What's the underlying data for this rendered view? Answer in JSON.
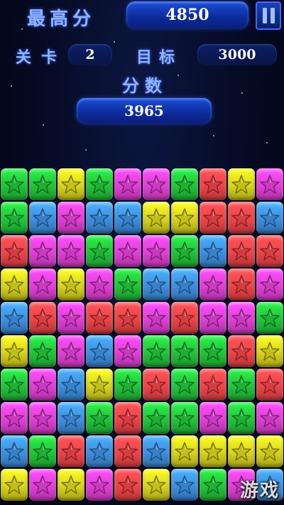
{
  "hud": {
    "high_score_label": "最高分",
    "high_score_value": "4850",
    "level_label": "关卡",
    "level_value": "2",
    "target_label": "目标",
    "target_value": "3000",
    "score_label": "分数",
    "score_value": "3965"
  },
  "board": {
    "columns": 10,
    "rows": 10,
    "colors": {
      "G": "#22c43a",
      "B": "#3d8fe0",
      "Y": "#d8d41c",
      "P": "#e23fd6",
      "R": "#ee4448"
    },
    "grid": [
      [
        "G",
        "G",
        "Y",
        "G",
        "P",
        "P",
        "G",
        "R",
        "Y",
        "P"
      ],
      [
        "G",
        "B",
        "P",
        "B",
        "B",
        "Y",
        "Y",
        "R",
        "R",
        "B"
      ],
      [
        "R",
        "P",
        "P",
        "G",
        "P",
        "P",
        "G",
        "B",
        "R",
        "R"
      ],
      [
        "Y",
        "P",
        "Y",
        "P",
        "G",
        "B",
        "B",
        "P",
        "R",
        "P"
      ],
      [
        "B",
        "R",
        "P",
        "R",
        "R",
        "P",
        "R",
        "P",
        "P",
        "G"
      ],
      [
        "Y",
        "G",
        "P",
        "B",
        "P",
        "G",
        "G",
        "G",
        "R",
        "Y"
      ],
      [
        "G",
        "P",
        "B",
        "Y",
        "G",
        "R",
        "G",
        "R",
        "G",
        "R"
      ],
      [
        "P",
        "P",
        "B",
        "G",
        "R",
        "G",
        "G",
        "P",
        "G",
        "P"
      ],
      [
        "B",
        "G",
        "R",
        "B",
        "R",
        "B",
        "Y",
        "Y",
        "Y",
        "Y"
      ],
      [
        "Y",
        "P",
        "Y",
        "P",
        "R",
        "Y",
        "B",
        "G",
        "P",
        "B"
      ]
    ]
  },
  "watermark": "游戏"
}
